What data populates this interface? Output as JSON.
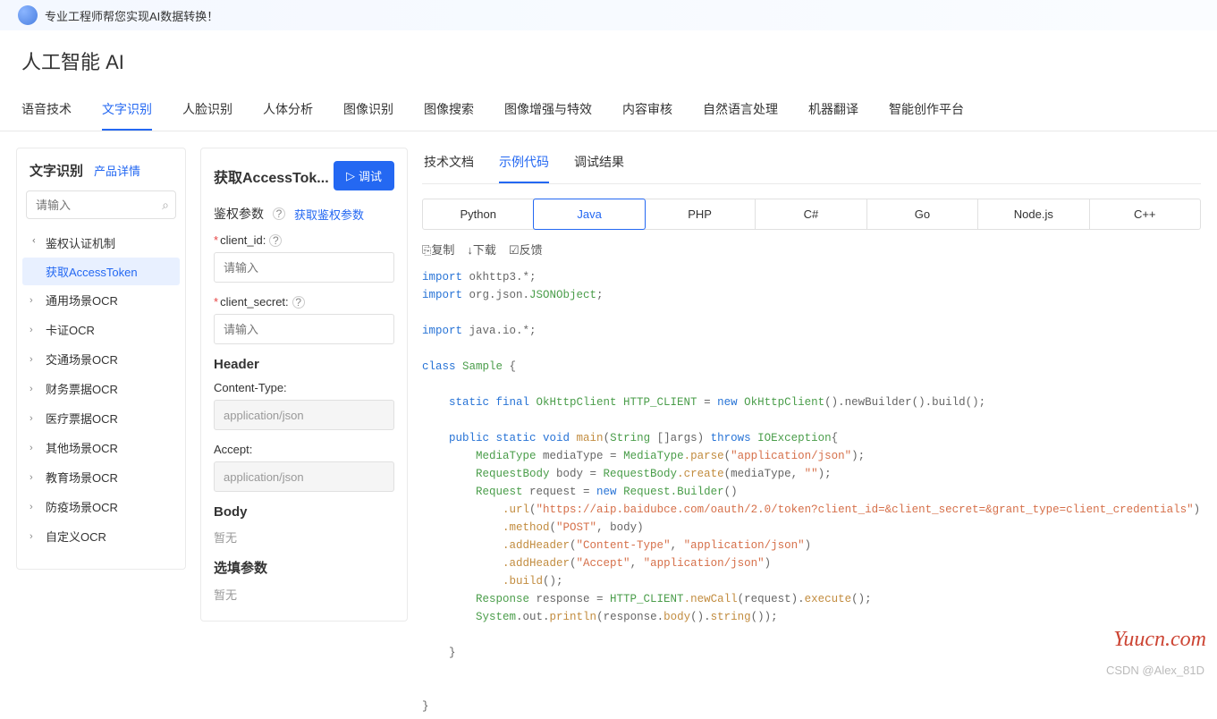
{
  "banner": {
    "text": "专业工程师帮您实现AI数据转换！"
  },
  "page": {
    "title": "人工智能 AI"
  },
  "main_tabs": [
    "语音技术",
    "文字识别",
    "人脸识别",
    "人体分析",
    "图像识别",
    "图像搜索",
    "图像增强与特效",
    "内容审核",
    "自然语言处理",
    "机器翻译",
    "智能创作平台"
  ],
  "main_tab_active": 1,
  "sidebar": {
    "title": "文字识别",
    "product_link": "产品详情",
    "search_placeholder": "请输入",
    "tree": [
      {
        "label": "鉴权认证机制",
        "expanded": true,
        "children": [
          {
            "label": "获取AccessToken",
            "active": true
          }
        ]
      },
      {
        "label": "通用场景OCR"
      },
      {
        "label": "卡证OCR"
      },
      {
        "label": "交通场景OCR"
      },
      {
        "label": "财务票据OCR"
      },
      {
        "label": "医疗票据OCR"
      },
      {
        "label": "其他场景OCR"
      },
      {
        "label": "教育场景OCR"
      },
      {
        "label": "防疫场景OCR"
      },
      {
        "label": "自定义OCR"
      }
    ]
  },
  "params_panel": {
    "title": "获取AccessTok...",
    "debug_btn": "调试",
    "auth_section": "鉴权参数",
    "get_auth_link": "获取鉴权参数",
    "fields": {
      "client_id_label": "client_id:",
      "client_id_placeholder": "请输入",
      "client_secret_label": "client_secret:",
      "client_secret_placeholder": "请输入"
    },
    "header_title": "Header",
    "headers": {
      "content_type_label": "Content-Type:",
      "content_type_value": "application/json",
      "accept_label": "Accept:",
      "accept_value": "application/json"
    },
    "body_title": "Body",
    "body_empty": "暂无",
    "optional_title": "选填参数",
    "optional_empty": "暂无"
  },
  "doc_tabs": [
    "技术文档",
    "示例代码",
    "调试结果"
  ],
  "doc_tab_active": 1,
  "lang_tabs": [
    "Python",
    "Java",
    "PHP",
    "C#",
    "Go",
    "Node.js",
    "C++"
  ],
  "lang_tab_active": 1,
  "code_actions": {
    "copy": "复制",
    "download": "下载",
    "feedback": "反馈"
  },
  "code": {
    "line1_kw": "import",
    "line1_rest": " okhttp3.*;",
    "line2_kw": "import",
    "line2_rest": " org.json.",
    "line2_cls": "JSONObject",
    "line2_end": ";",
    "line3_kw": "import",
    "line3_rest": " java.io.*;",
    "line4_kw": "class",
    "line4_cls": " Sample",
    "line4_rest": " {",
    "line5_kw": "static final",
    "line5_cls": " OkHttpClient HTTP_CLIENT",
    "line5_mid": " = ",
    "line5_new": "new",
    "line5_cls2": " OkHttpClient",
    "line5_rest": "().newBuilder().build();",
    "line6_kw": "public static void",
    "line6_mth": " main",
    "line6_open": "(",
    "line6_cls": "String",
    "line6_args": " []args) ",
    "line6_throws": "throws",
    "line6_exc": " IOException",
    "line6_end": "{",
    "line7_cls": "MediaType",
    "line7_var": " mediaType = ",
    "line7_cls2": "MediaType",
    "line7_mth": ".parse",
    "line7_open": "(",
    "line7_str": "\"application/json\"",
    "line7_end": ");",
    "line8_cls": "RequestBody",
    "line8_var": " body = ",
    "line8_cls2": "RequestBody",
    "line8_mth": ".create",
    "line8_open": "(mediaType, ",
    "line8_str": "\"\"",
    "line8_end": ");",
    "line9_cls": "Request",
    "line9_var": " request = ",
    "line9_new": "new",
    "line9_cls2": " Request.Builder",
    "line9_end": "()",
    "line10_mth": ".url",
    "line10_open": "(",
    "line10_str": "\"https://aip.baidubce.com/oauth/2.0/token?client_id=&client_secret=&grant_type=client_credentials\"",
    "line10_end": ")",
    "line11_mth": ".method",
    "line11_open": "(",
    "line11_str1": "\"POST\"",
    "line11_mid": ", body)",
    "line12_mth": ".addHeader",
    "line12_open": "(",
    "line12_str1": "\"Content-Type\"",
    "line12_mid": ", ",
    "line12_str2": "\"application/json\"",
    "line12_end": ")",
    "line13_mth": ".addHeader",
    "line13_open": "(",
    "line13_str1": "\"Accept\"",
    "line13_mid": ", ",
    "line13_str2": "\"application/json\"",
    "line13_end": ")",
    "line14_mth": ".build",
    "line14_end": "();",
    "line15_cls": "Response",
    "line15_var": " response = ",
    "line15_cls2": "HTTP_CLIENT",
    "line15_mth": ".newCall",
    "line15_open": "(request).",
    "line15_mth2": "execute",
    "line15_end": "();",
    "line16_cls": "System",
    "line16_out": ".out.",
    "line16_mth": "println",
    "line16_open": "(response.",
    "line16_mth2": "body",
    "line16_mid": "().",
    "line16_mth3": "string",
    "line16_end": "());",
    "close1": "}",
    "close2": "}"
  },
  "watermark": "Yuucn.com",
  "csdn": "CSDN @Alex_81D"
}
